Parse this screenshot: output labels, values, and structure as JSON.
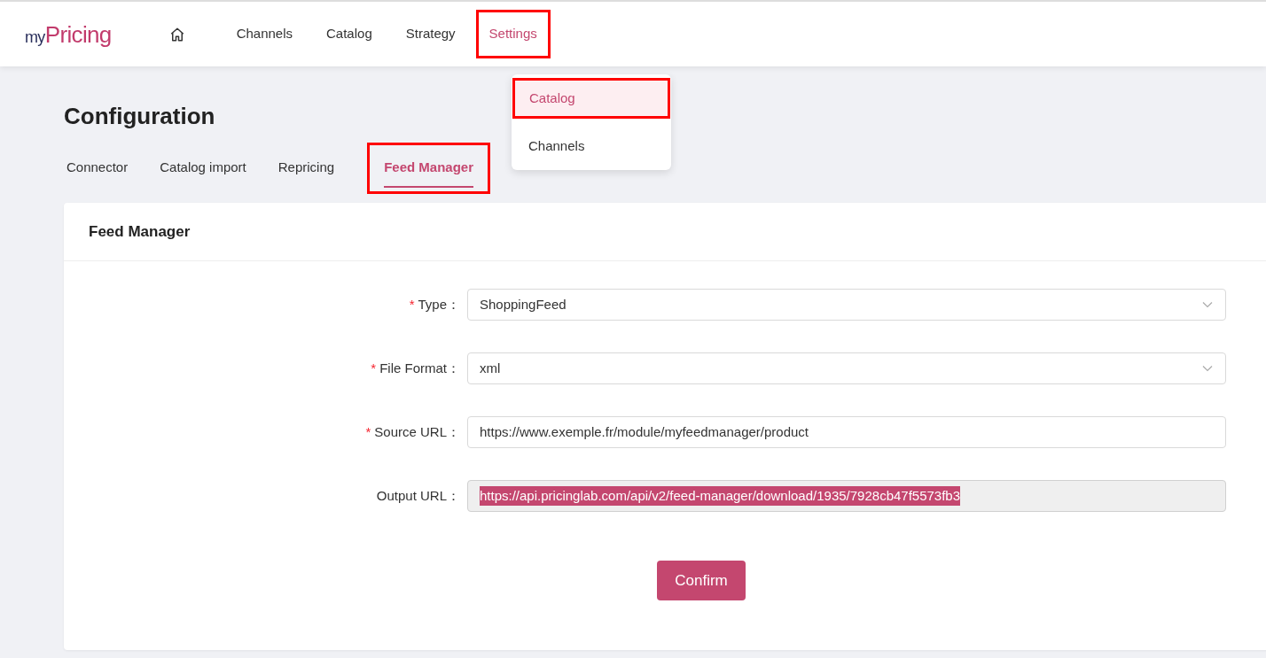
{
  "logo": {
    "prefix": "my",
    "name": "Pricing"
  },
  "nav": [
    {
      "kind": "home",
      "selected": false,
      "highlighted": false
    },
    {
      "label": "Channels",
      "selected": false,
      "highlighted": false
    },
    {
      "label": "Catalog",
      "selected": false,
      "highlighted": false
    },
    {
      "label": "Strategy",
      "selected": false,
      "highlighted": false
    },
    {
      "label": "Settings",
      "selected": true,
      "highlighted": true
    }
  ],
  "settings_menu": [
    {
      "label": "Catalog",
      "selected": true,
      "highlighted": true
    },
    {
      "label": "Channels",
      "selected": false,
      "highlighted": false
    }
  ],
  "page_title": "Configuration",
  "tabs": [
    {
      "label": "Connector",
      "selected": false,
      "highlighted": false
    },
    {
      "label": "Catalog import",
      "selected": false,
      "highlighted": false
    },
    {
      "label": "Repricing",
      "selected": false,
      "highlighted": false
    },
    {
      "label": "Feed Manager",
      "selected": true,
      "highlighted": true
    }
  ],
  "card": {
    "title": "Feed Manager",
    "fields": [
      {
        "required_mark": "*",
        "label": "Type：",
        "kind": "select",
        "value": "ShoppingFeed",
        "disabled": false,
        "selected_text": false
      },
      {
        "required_mark": "*",
        "label": "File Format：",
        "kind": "select",
        "value": "xml",
        "disabled": false,
        "selected_text": false
      },
      {
        "required_mark": "*",
        "label": "Source URL：",
        "kind": "text",
        "value": "https://www.exemple.fr/module/myfeedmanager/product",
        "disabled": false,
        "selected_text": false
      },
      {
        "label": "Output URL：",
        "kind": "text",
        "value": "https://api.pricinglab.com/api/v2/feed-manager/download/1935/7928cb47f5573fb3",
        "disabled": true,
        "selected_text": true
      }
    ],
    "confirm_button": "Confirm"
  }
}
